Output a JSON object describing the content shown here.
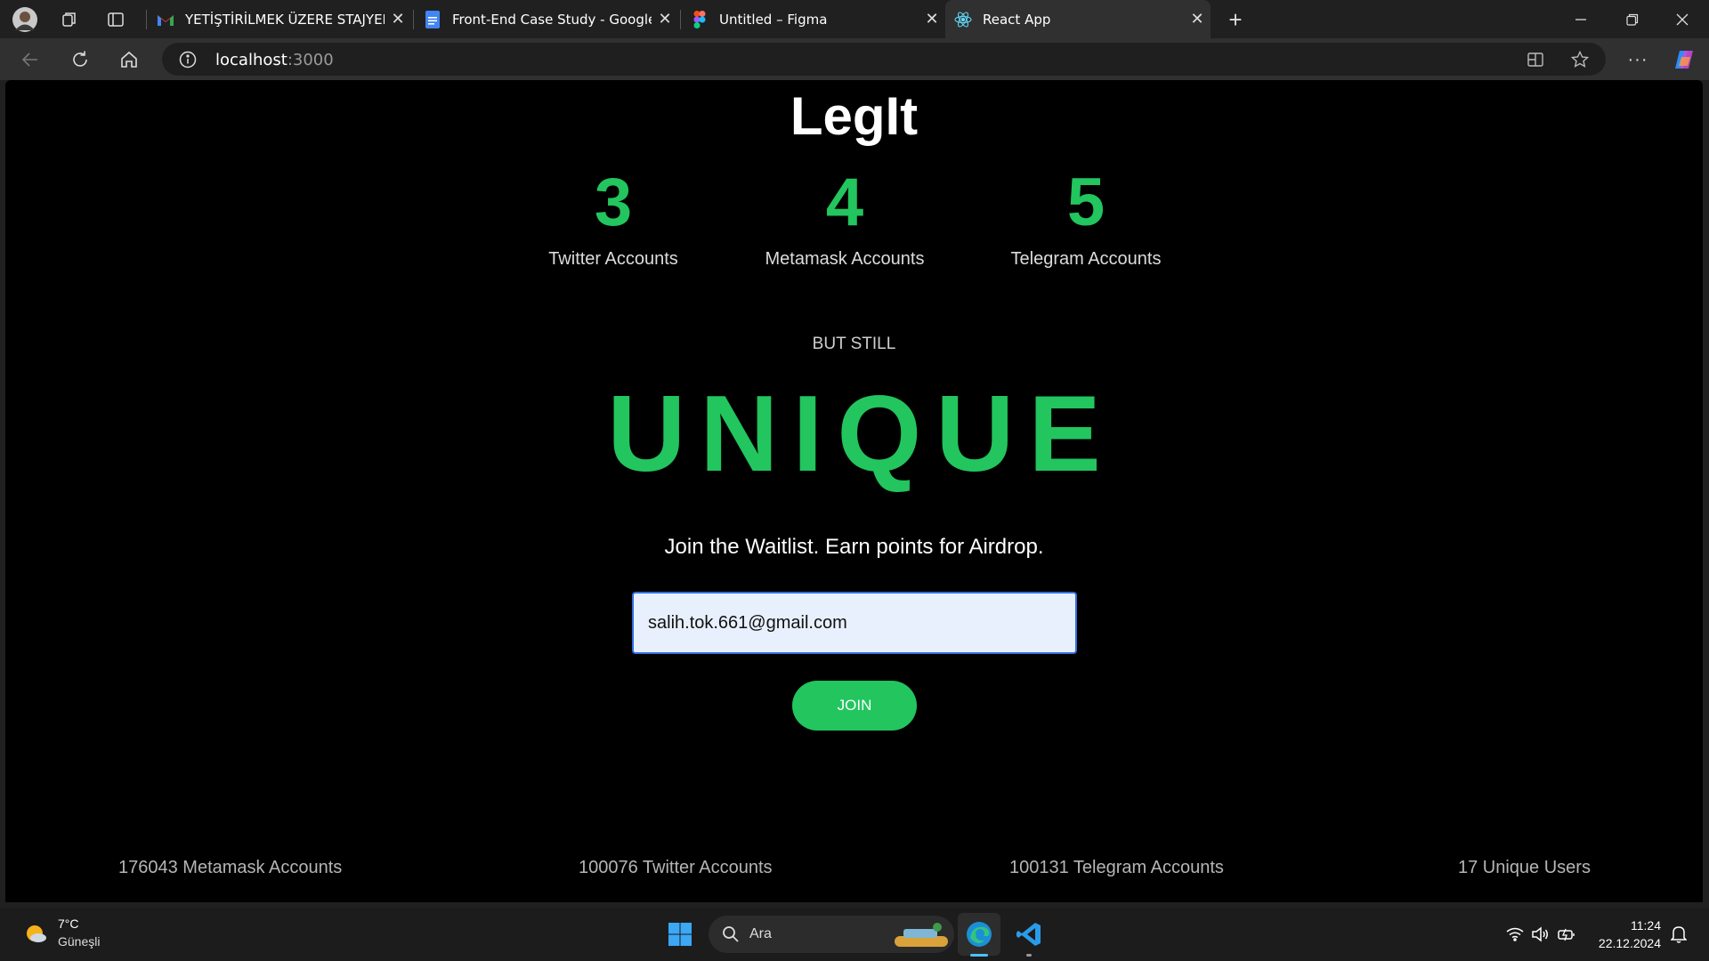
{
  "browser": {
    "tabs": [
      {
        "title": "YETİŞTİRİLMEK ÜZERE STAJYER - salih",
        "icon": "gmail-icon"
      },
      {
        "title": "Front-End Case Study - Google Docs",
        "icon": "google-docs-icon"
      },
      {
        "title": "Untitled – Figma",
        "icon": "figma-icon"
      },
      {
        "title": "React App",
        "icon": "react-icon",
        "active": true
      }
    ],
    "url_host": "localhost",
    "url_port": ":3000"
  },
  "page": {
    "title": "LegIt",
    "stats": [
      {
        "value": "3",
        "label": "Twitter Accounts"
      },
      {
        "value": "4",
        "label": "Metamask Accounts"
      },
      {
        "value": "5",
        "label": "Telegram Accounts"
      }
    ],
    "but_still": "BUT STILL",
    "unique": "UNIQUE",
    "tagline": "Join the Waitlist. Earn points for Airdrop.",
    "email_value": "salih.tok.661@gmail.com",
    "join_label": "JOIN",
    "footer": [
      "176043 Metamask Accounts",
      "100076 Twitter Accounts",
      "100131 Telegram Accounts",
      "17 Unique Users"
    ],
    "accent_color": "#22c55e"
  },
  "taskbar": {
    "weather_temp": "7°C",
    "weather_desc": "Güneşli",
    "search_placeholder": "Ara",
    "time": "11:24",
    "date": "22.12.2024"
  }
}
